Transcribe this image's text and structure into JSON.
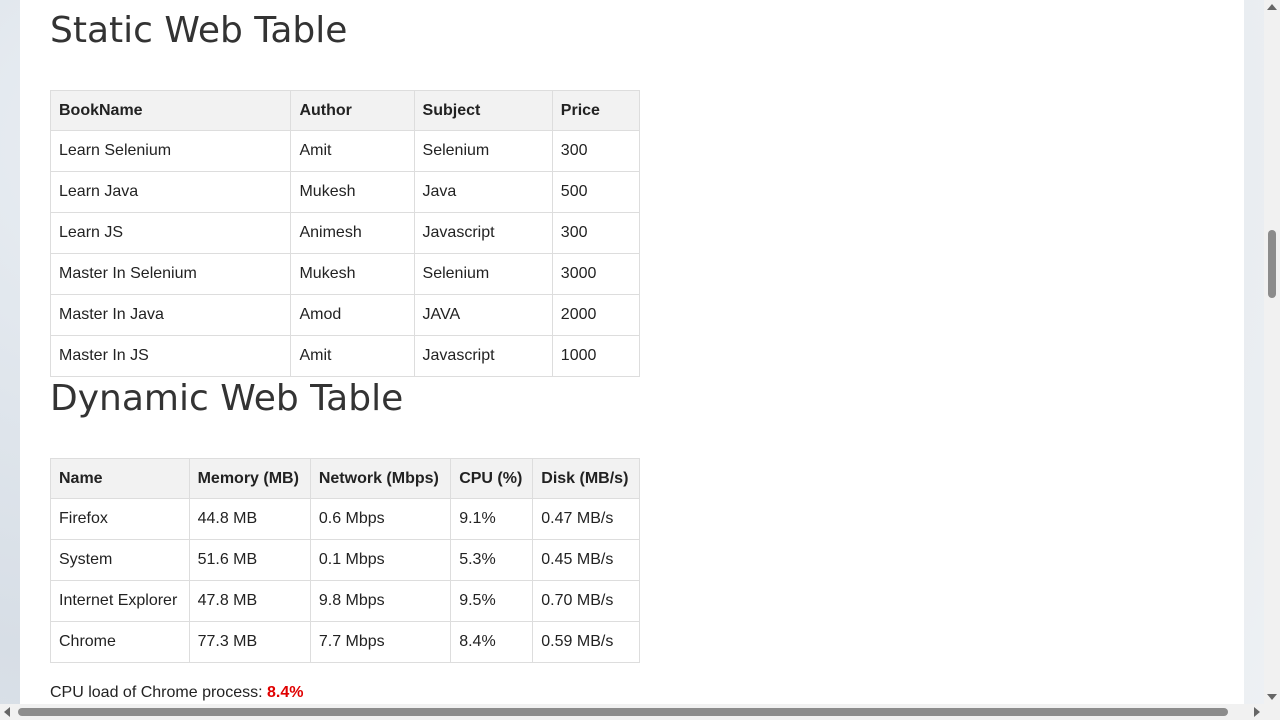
{
  "static_section": {
    "title": "Static Web Table",
    "headers": [
      "BookName",
      "Author",
      "Subject",
      "Price"
    ],
    "rows": [
      [
        "Learn Selenium",
        "Amit",
        "Selenium",
        "300"
      ],
      [
        "Learn Java",
        "Mukesh",
        "Java",
        "500"
      ],
      [
        "Learn JS",
        "Animesh",
        "Javascript",
        "300"
      ],
      [
        "Master In Selenium",
        "Mukesh",
        "Selenium",
        "3000"
      ],
      [
        "Master In Java",
        "Amod",
        "JAVA",
        "2000"
      ],
      [
        "Master In JS",
        "Amit",
        "Javascript",
        "1000"
      ]
    ]
  },
  "dynamic_section": {
    "title": "Dynamic Web Table",
    "headers": [
      "Name",
      "Memory (MB)",
      "Network (Mbps)",
      "CPU (%)",
      "Disk (MB/s)"
    ],
    "rows": [
      [
        "Firefox",
        "44.8 MB",
        "0.6 Mbps",
        "9.1%",
        "0.47 MB/s"
      ],
      [
        "System",
        "51.6 MB",
        "0.1 Mbps",
        "5.3%",
        "0.45 MB/s"
      ],
      [
        "Internet Explorer",
        "47.8 MB",
        "9.8 Mbps",
        "9.5%",
        "0.70 MB/s"
      ],
      [
        "Chrome",
        "77.3 MB",
        "7.7 Mbps",
        "8.4%",
        "0.59 MB/s"
      ]
    ],
    "cpu_label": "CPU load of Chrome process: ",
    "cpu_value": "8.4%"
  },
  "colors": {
    "cpu_value": "#e00000",
    "header_bg": "#f2f2f2",
    "border": "#dddddd"
  }
}
